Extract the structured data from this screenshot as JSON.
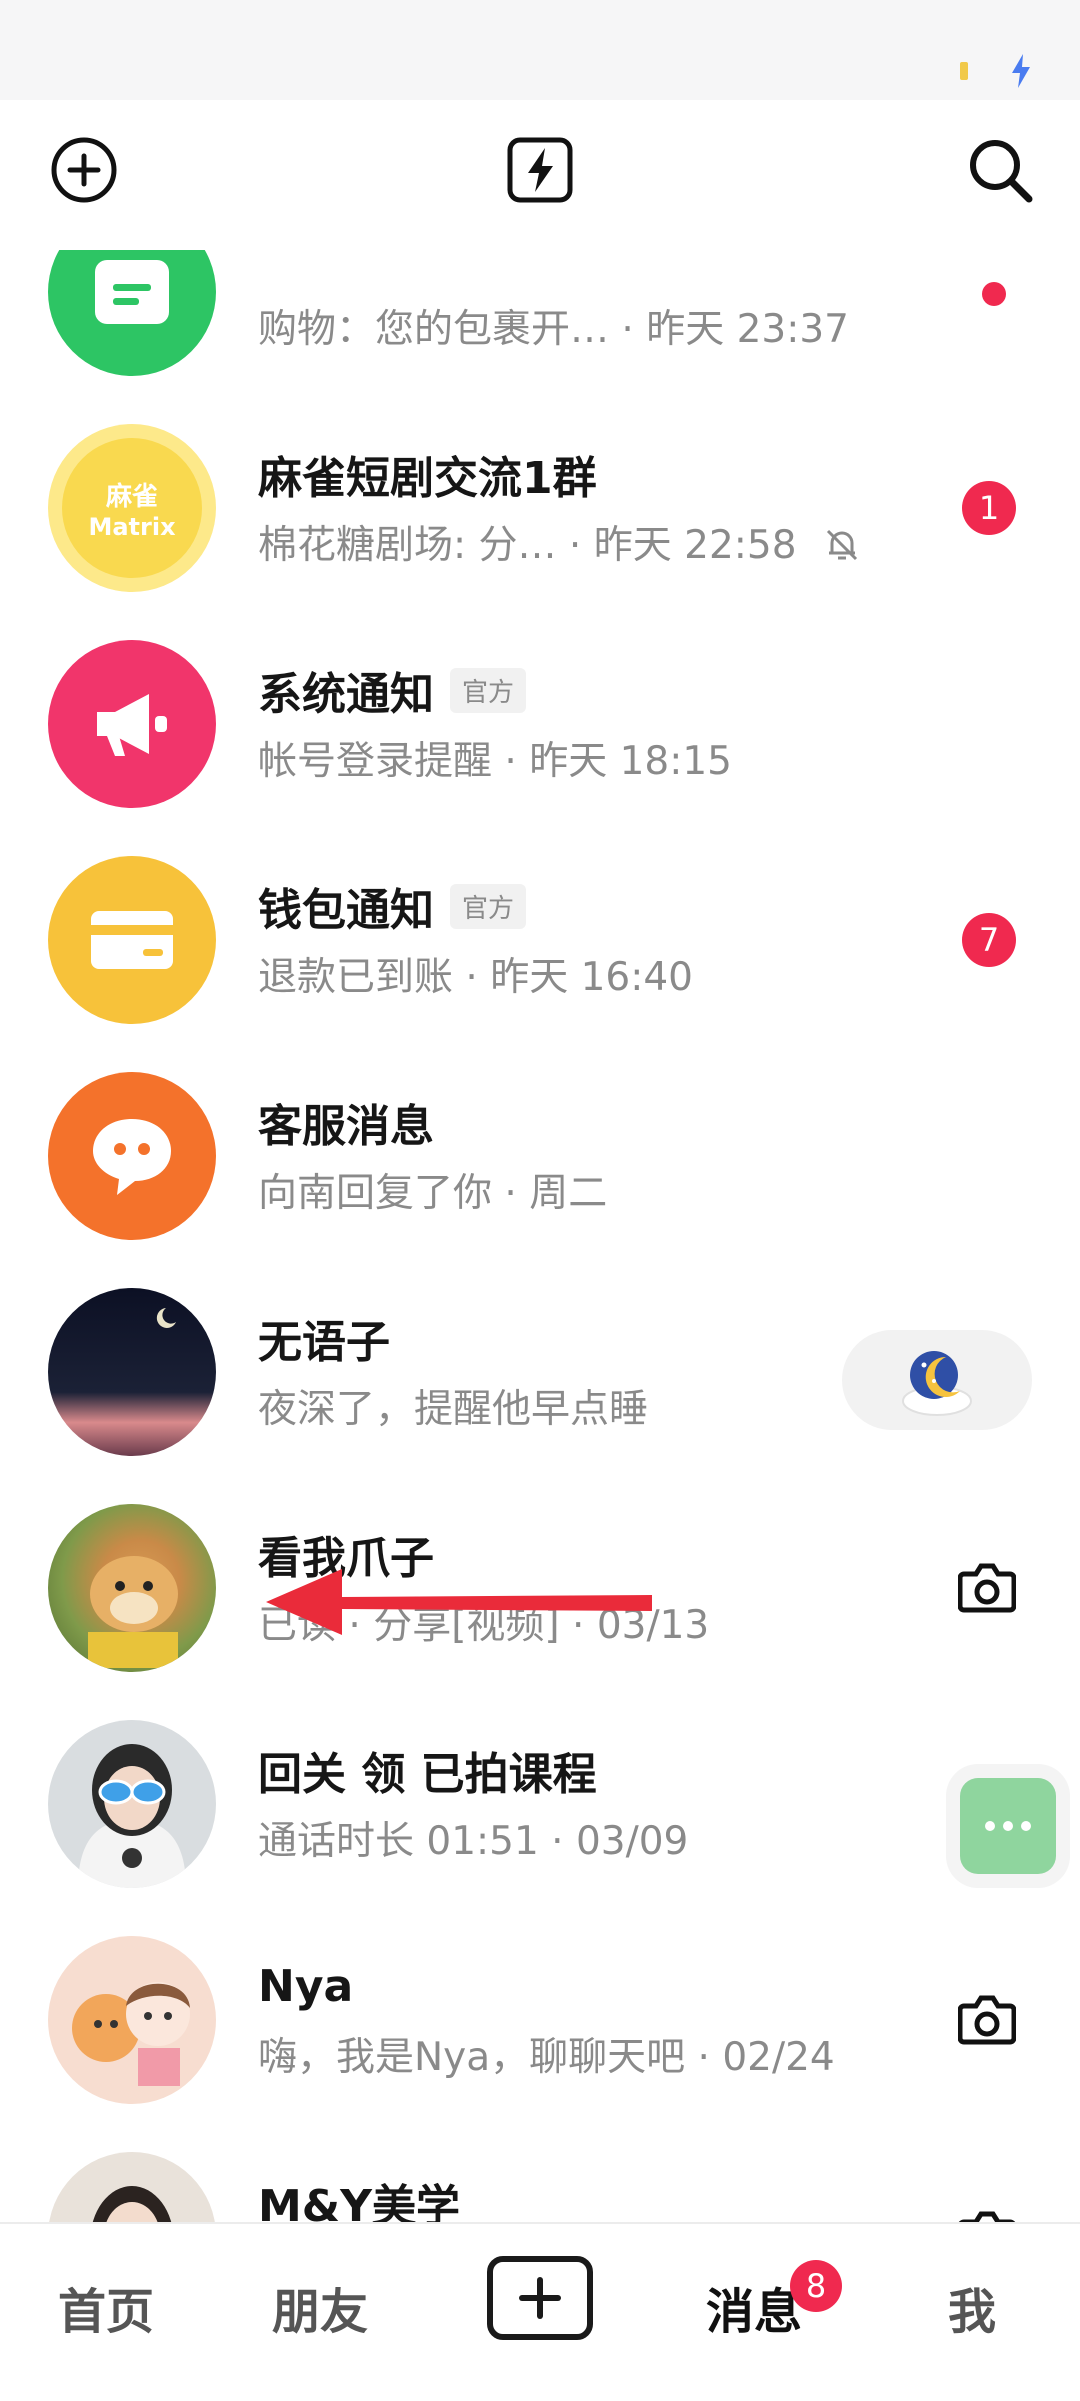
{
  "colors": {
    "accent_red": "#f0294f",
    "green": "#2dc564",
    "yellow": "#f7c23a",
    "pink_red": "#f1356b",
    "orange": "#f4722b"
  },
  "header": {
    "left_icon": "plus-circle-icon",
    "center_icon": "lightning-box-icon",
    "right_icon": "search-icon"
  },
  "conversations": [
    {
      "name": "",
      "preview": "购物：您的包裹开… · 昨天 23:37",
      "avatar_icon": "chat-box-icon",
      "has_dot": true
    },
    {
      "name": "麻雀短剧交流1群",
      "preview": "棉花糖剧场: 分…  · 昨天 22:58",
      "avatar_text_1": "麻雀",
      "avatar_text_2": "Matrix",
      "muted_icon": "bell-off-icon",
      "badge": "1"
    },
    {
      "name": "系统通知",
      "tag": "官方",
      "preview": "帐号登录提醒 · 昨天 18:15",
      "avatar_icon": "megaphone-icon"
    },
    {
      "name": "钱包通知",
      "tag": "官方",
      "preview": "退款已到账 · 昨天 16:40",
      "avatar_icon": "card-icon",
      "badge": "7"
    },
    {
      "name": "客服消息",
      "preview": "向南回复了你 · 周二",
      "avatar_icon": "chat-bubble-icon"
    },
    {
      "name": "无语子",
      "preview": "夜深了，提醒他早点睡",
      "side_icon": "moon-sleep-icon"
    },
    {
      "name": "看我爪子",
      "preview": "已读 · 分享[视频] · 03/13",
      "side_icon": "camera-icon"
    },
    {
      "name": "回关 领 已拍课程",
      "preview": "通话时长 01:51 · 03/09"
    },
    {
      "name": "Nya",
      "preview": "嗨，我是Nya，聊聊天吧 · 02/24",
      "side_icon": "camera-icon"
    },
    {
      "name": "M&Y美学",
      "preview": "",
      "side_icon": "camera-icon"
    }
  ],
  "floating_button": {
    "icon": "more-dots-icon"
  },
  "tabbar": {
    "home": "首页",
    "friends": "朋友",
    "create_icon": "plus-square-icon",
    "messages": "消息",
    "messages_badge": "8",
    "me": "我"
  }
}
